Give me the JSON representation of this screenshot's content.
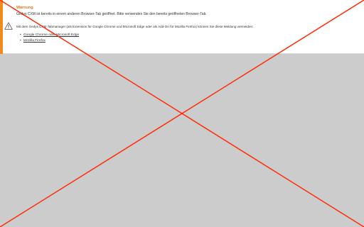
{
  "warning": {
    "title": "Warnung",
    "message": "Gedys CXM ist bereits in einem anderen Browser-Tab geöffnet. Bitte verwenden Sie den bereits geöffneten Browser-Tab.",
    "info": "Mit dem Gedys CXM Tabmanager (als Extension für Google Chrome und Microsoft Edge oder als Add-On für Mozilla Firefox) können Sie diese Meldung vermeiden:",
    "links": [
      {
        "label": "Google Chrome oder Microsoft Edge"
      },
      {
        "label": "Mozilla Firefox"
      }
    ],
    "icon": "warning-triangle-icon"
  },
  "colors": {
    "accent": "#f08a1a",
    "title": "#e07a14",
    "background": "#cccccc",
    "cross": "#ff2a00"
  }
}
